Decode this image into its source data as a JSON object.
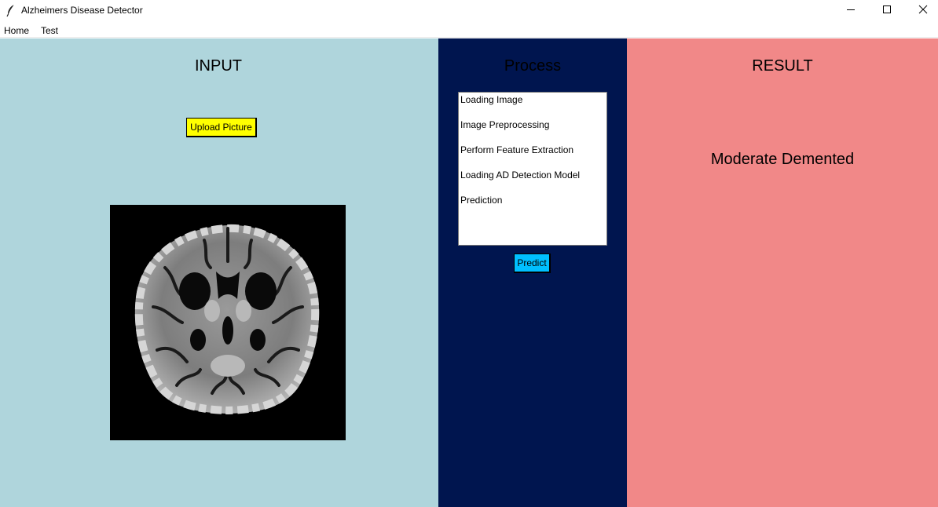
{
  "window": {
    "title": "Alzheimers Disease Detector",
    "icon": "feather-icon",
    "controls": [
      "minimize-icon",
      "maximize-icon",
      "close-icon"
    ]
  },
  "menu": {
    "items": [
      "Home",
      "Test"
    ]
  },
  "input_panel": {
    "title": "INPUT",
    "upload_label": "Upload Picture",
    "bg_color": "#afd5dc",
    "button_color": "#ffff00"
  },
  "process_panel": {
    "title": "Process",
    "steps": [
      "Loading Image",
      "Image Preprocessing",
      "Perform Feature Extraction",
      "Loading AD Detection Model",
      "Prediction"
    ],
    "predict_label": "Predict",
    "bg_color": "#00154f",
    "button_color": "#00bfff"
  },
  "result_panel": {
    "title": "RESULT",
    "result": "Moderate Demented",
    "bg_color": "#f18888"
  }
}
